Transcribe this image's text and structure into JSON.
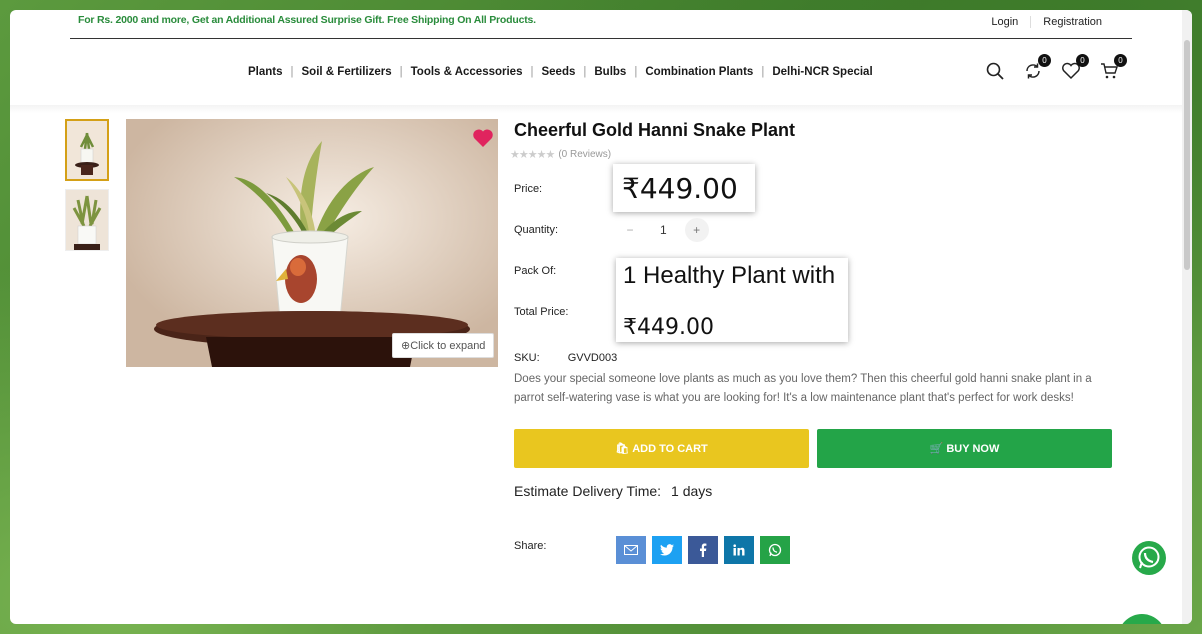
{
  "header": {
    "promo": "For Rs. 2000 and more, Get an Additional Assured Surprise Gift. Free Shipping On All Products.",
    "login": "Login",
    "registration": "Registration",
    "nav": [
      "Plants",
      "Soil & Fertilizers",
      "Tools & Accessories",
      "Seeds",
      "Bulbs",
      "Combination Plants",
      "Delhi-NCR Special"
    ],
    "compare_count": "0",
    "wishlist_count": "0",
    "cart_count": "0"
  },
  "product": {
    "title": "Cheerful Gold Hanni Snake Plant",
    "reviews": "(0 Reviews)",
    "price_label": "Price:",
    "price": "₹449.00",
    "quantity_label": "Quantity:",
    "quantity": "1",
    "pack_label": "Pack Of:",
    "pack_value": "1 Healthy Plant with",
    "total_label": "Total Price:",
    "total_price": "₹449.00",
    "sku_label": "SKU:",
    "sku": "GVVD003",
    "description": "Does your special someone love plants as much as you love them? Then this cheerful gold hanni snake plant in a parrot self-watering vase is what you are looking for! It's a low maintenance plant that's perfect for work desks!",
    "expand": "Click to expand",
    "add_to_cart": "ADD TO CART",
    "buy_now": "BUY NOW",
    "delivery_label": "Estimate Delivery Time:",
    "delivery_value": "1 days",
    "share_label": "Share:",
    "share_icons": [
      "email-icon",
      "twitter-icon",
      "facebook-icon",
      "linkedin-icon",
      "whatsapp-icon"
    ]
  },
  "colors": {
    "accent_green": "#23a448",
    "cart_yellow": "#e9c61f",
    "wishlist_red": "#e0245e"
  }
}
